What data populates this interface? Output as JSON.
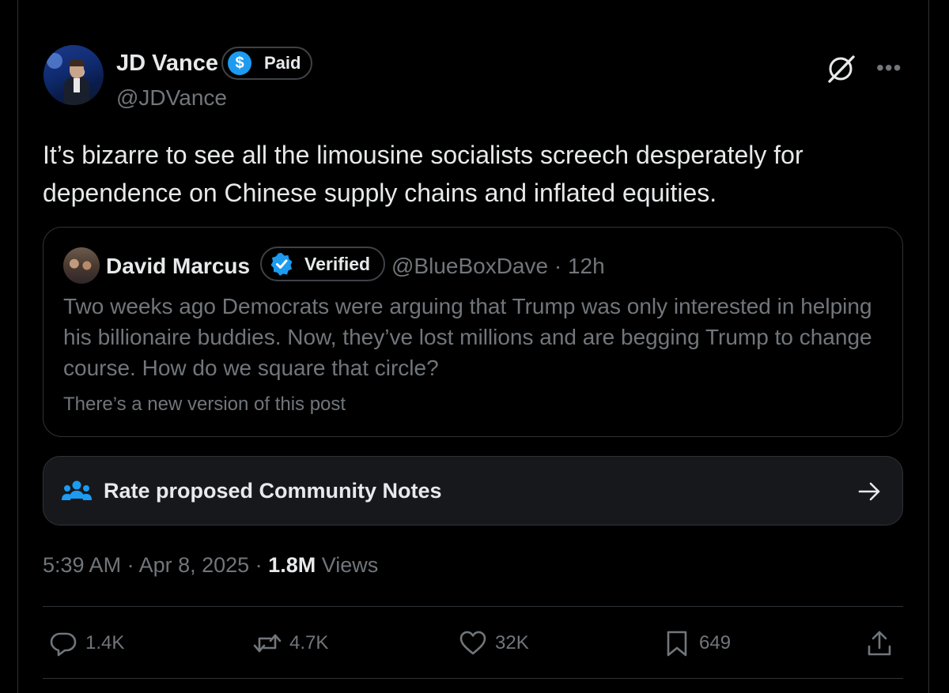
{
  "author": {
    "name": "JD Vance",
    "badge_label": "Paid",
    "badge_symbol": "$",
    "handle": "@JDVance"
  },
  "tweet": {
    "text_line1": "It’s bizarre to see all the limousine socialists screech desperately for",
    "text_line2": "dependence on Chinese supply chains and inflated equities."
  },
  "quote": {
    "name": "David Marcus",
    "badge_label": "Verified",
    "handle_time": "@BlueBoxDave · 12h",
    "text": "Two weeks ago Democrats were arguing that Trump was only interested in helping his billionaire buddies. Now, they’ve lost millions and are begging Trump to change course. How do we square that circle?",
    "version_note": "There’s a new version of this post"
  },
  "community_notes": {
    "label": "Rate proposed Community Notes"
  },
  "meta": {
    "time_date": "5:39 AM · Apr 8, 2025 · ",
    "views_count": "1.8M",
    "views_label": " Views"
  },
  "actions": {
    "replies": "1.4K",
    "reposts": "4.7K",
    "likes": "32K",
    "bookmarks": "649"
  },
  "icons": [
    "grok-icon",
    "more-icon",
    "dollar-icon",
    "verified-check-icon",
    "people-icon",
    "arrow-right-icon",
    "reply-icon",
    "repost-icon",
    "like-icon",
    "bookmark-icon",
    "share-icon"
  ],
  "colors": {
    "background": "#000000",
    "primary_text": "#e7e9ea",
    "secondary_text": "#71767b",
    "accent": "#1d9bf0",
    "border": "#2f3336"
  }
}
